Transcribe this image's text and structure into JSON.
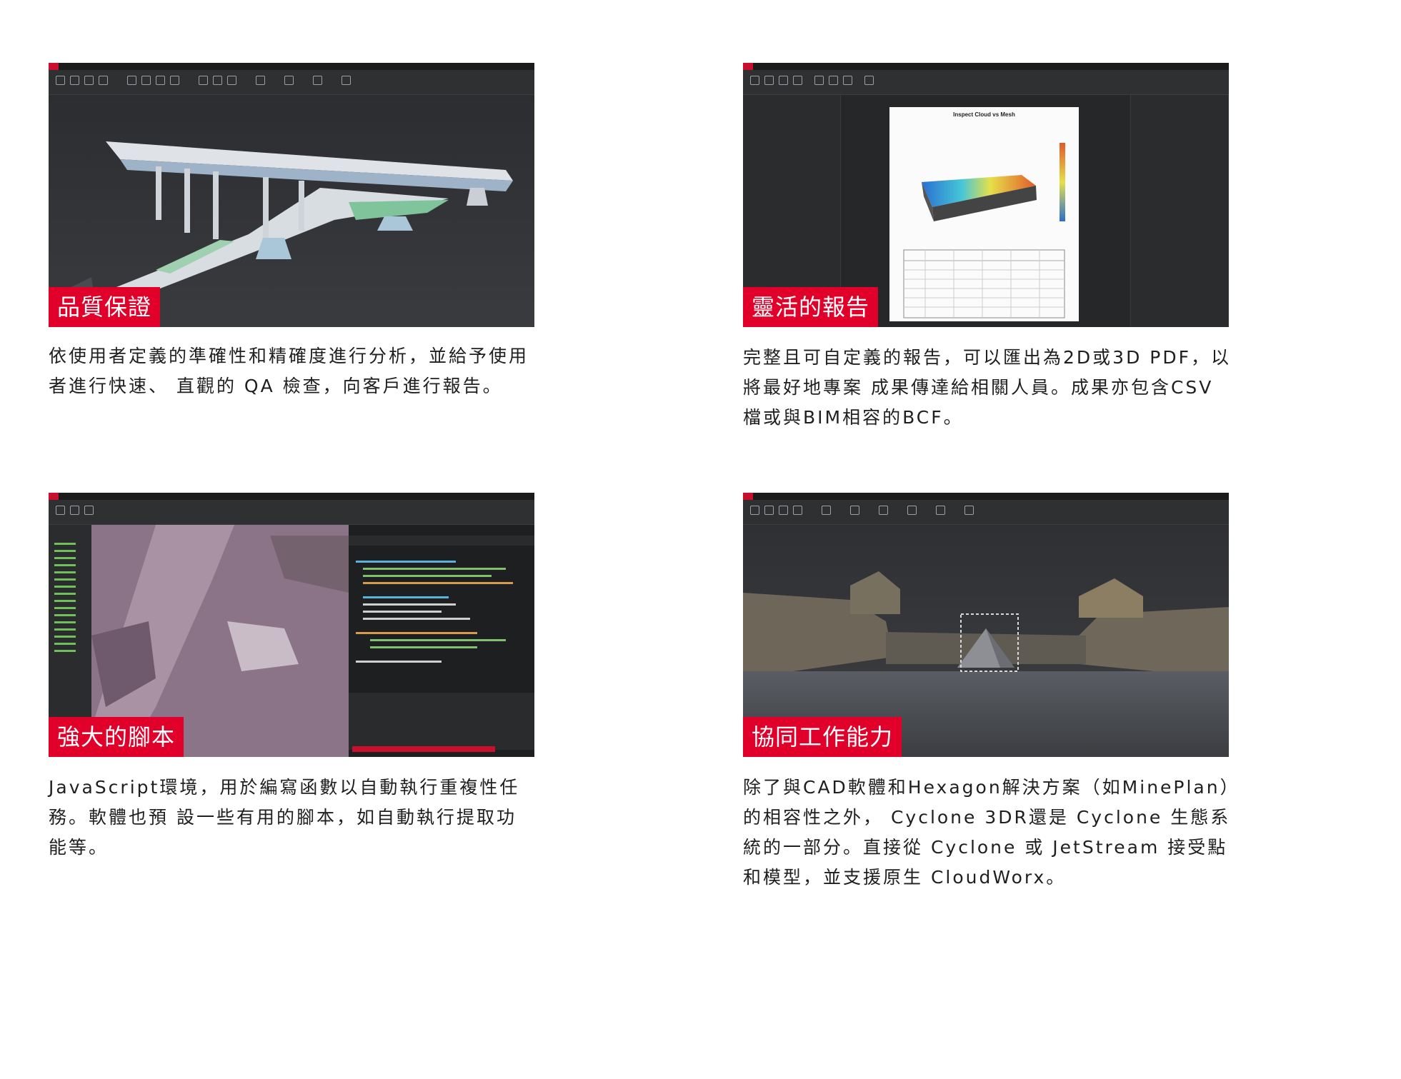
{
  "cards": [
    {
      "label": "品質保證",
      "desc": "依使用者定義的準確性和精確度進行分析，並給予使用者進行快速、 直觀的 QA 檢查，向客戶進行報告。"
    },
    {
      "label": "靈活的報告",
      "desc": "完整且可自定義的報告，可以匯出為2D或3D PDF，以將最好地專案 成果傳達給相關人員。成果亦包含CSV檔或與BIM相容的BCF。",
      "report_title": "Inspect Cloud vs Mesh"
    },
    {
      "label": "強大的腳本",
      "desc": "JavaScript環境，用於編寫函數以自動執行重複性任務。軟體也預 設一些有用的腳本，如自動執行提取功能等。"
    },
    {
      "label": "協同工作能力",
      "desc": "除了與CAD軟體和Hexagon解決方案（如MinePlan）的相容性之外， Cyclone 3DR還是 Cyclone 生態系統的一部分。直接從 Cyclone 或 JetStream 接受點和模型，並支援原生 CloudWorx。"
    }
  ],
  "colors": {
    "accent": "#e0002a",
    "ui_dark": "#262729"
  }
}
